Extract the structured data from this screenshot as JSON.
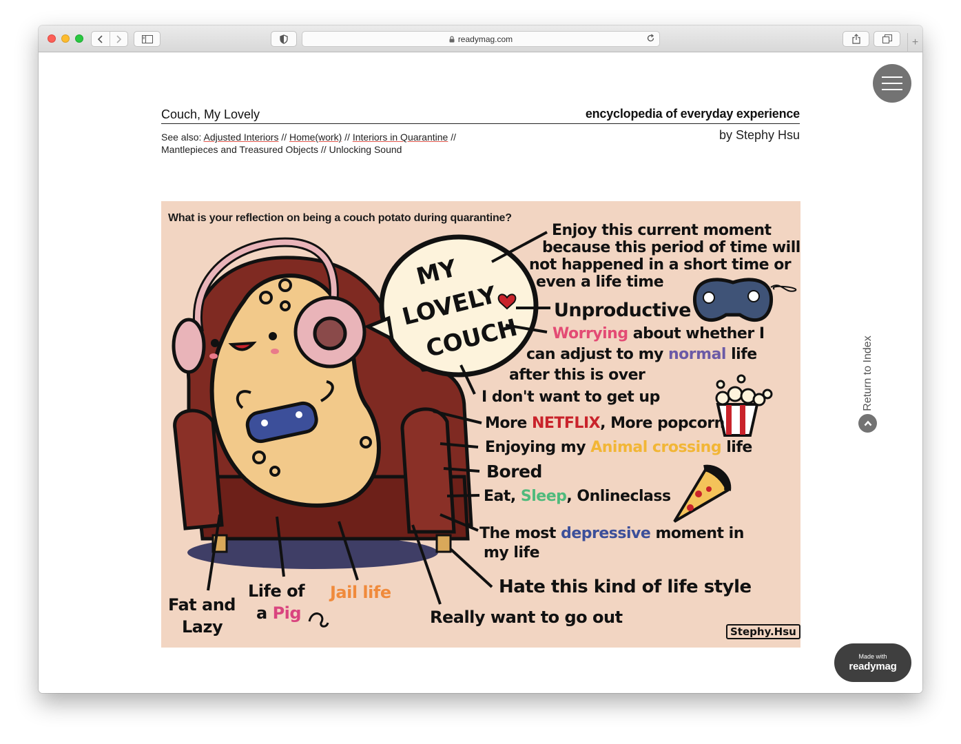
{
  "browser": {
    "url": "readymag.com"
  },
  "page": {
    "title": "Couch, My Lovely",
    "site_title": "encyclopedia of everyday experience",
    "author": "by Stephy Hsu",
    "see_also_label": "See also:",
    "see_also_links": [
      "Adjusted Interiors",
      "Home(work)",
      "Interiors in Quarantine"
    ],
    "see_also_plain": [
      "Mantlepieces and Treasured Objects",
      "Unlocking Sound"
    ],
    "separator": "//"
  },
  "side_nav": {
    "return_label": "Return to Index"
  },
  "badge": {
    "small": "Made with",
    "brand": "readymag"
  },
  "illustration": {
    "question": "What is your reflection on being a couch potato during quarantine?",
    "bubble_lines": [
      "MY",
      "LOVELY",
      "COUCH"
    ],
    "notes": {
      "enjoy_1": "Enjoy this current moment",
      "enjoy_2": "because this period of time will",
      "enjoy_3": "not happened in a short time or",
      "enjoy_4": "even a life time",
      "unproductive": "Unproductive",
      "worrying": "Worrying",
      "worry_rest": "about whether I",
      "adjust_1": "can adjust to my",
      "normal": "normal",
      "life_1": "life",
      "after": "after this is over",
      "dont_want": "I don't want to get up",
      "more_1": "More",
      "netflix": "NETFLIX",
      "more_2": ", More popcorn",
      "enjoying": "Enjoying my",
      "animal_crossing": "Animal crossing",
      "life_2": "life",
      "bored": "Bored",
      "eat": "Eat,",
      "sleep": "Sleep",
      "online": ", Onlineclass",
      "most": "The most",
      "depressive": "depressive",
      "moment": "moment in",
      "my_life": "my life",
      "hate": "Hate this kind of life style",
      "go_out": "Really want to go out",
      "fat_1": "Fat and",
      "fat_2": "Lazy",
      "pig_1": "Life of",
      "pig_a": "a",
      "pig_2": "Pig",
      "jail": "Jail life"
    },
    "signature": "Stephy.Hsu"
  },
  "colors": {
    "art_background": "#f2d5c2",
    "couch": "#7f2a22",
    "potato": "#f2c98a",
    "headphones": "#e9b4b9",
    "controller": "#3c4f9a",
    "accent_link_underline": "#e2574c"
  }
}
